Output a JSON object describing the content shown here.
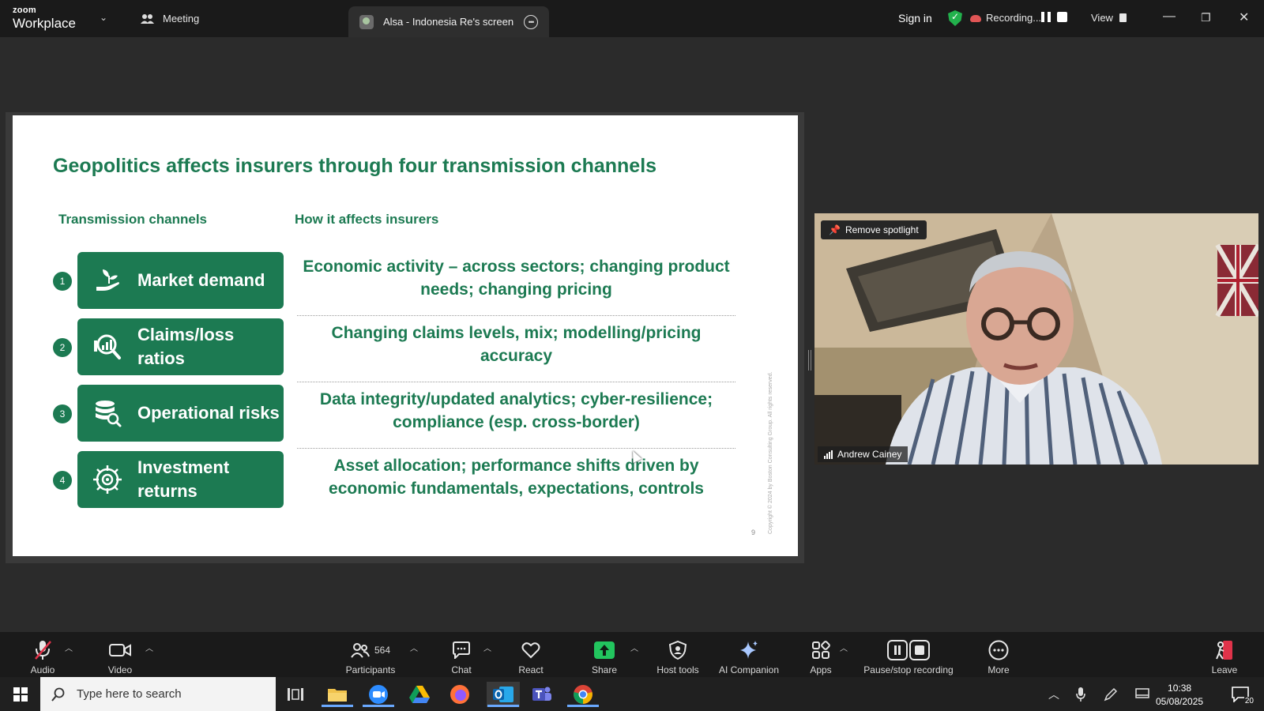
{
  "app": {
    "logo_small": "zoom",
    "logo_big": "Workplace",
    "meeting_label": "Meeting",
    "share_tab_label": "Alsa - Indonesia Re's screen",
    "sign_in": "Sign in",
    "recording_label": "Recording...",
    "view_label": "View"
  },
  "slide": {
    "title": "Geopolitics affects insurers through four transmission channels",
    "col1_header": "Transmission channels",
    "col2_header": "How it affects insurers",
    "rows": [
      {
        "num": "1",
        "label": "Market demand",
        "desc": "Economic activity – across sectors; changing product needs; changing pricing",
        "icon": "hand-plant-icon"
      },
      {
        "num": "2",
        "label": "Claims/loss ratios",
        "desc": "Changing claims levels, mix; modelling/pricing accuracy",
        "icon": "magnifier-chart-icon"
      },
      {
        "num": "3",
        "label": "Operational risks",
        "desc": "Data integrity/updated analytics; cyber-resilience; compliance (esp. cross-border)",
        "icon": "database-search-icon"
      },
      {
        "num": "4",
        "label": "Investment returns",
        "desc": "Asset allocation; performance shifts driven by economic fundamentals, expectations, controls",
        "icon": "investment-target-icon"
      }
    ],
    "page_number": "9",
    "copyright": "Copyright © 2024 by Boston Consulting Group. All rights reserved."
  },
  "video": {
    "spotlight_button": "Remove spotlight",
    "participant_name": "Andrew Cainey"
  },
  "toolbar": {
    "audio": "Audio",
    "video": "Video",
    "participants": "Participants",
    "participants_count": "564",
    "chat": "Chat",
    "react": "React",
    "share": "Share",
    "host_tools": "Host tools",
    "ai_companion": "AI Companion",
    "apps": "Apps",
    "pause_stop_recording": "Pause/stop recording",
    "more": "More",
    "leave": "Leave"
  },
  "taskbar": {
    "search_placeholder": "Type here to search",
    "time": "10:38",
    "date": "05/08/2025",
    "notification_count": "20"
  },
  "colors": {
    "slide_green": "#1c7a52",
    "share_green": "#22c55e",
    "leave_red": "#e0334a"
  }
}
